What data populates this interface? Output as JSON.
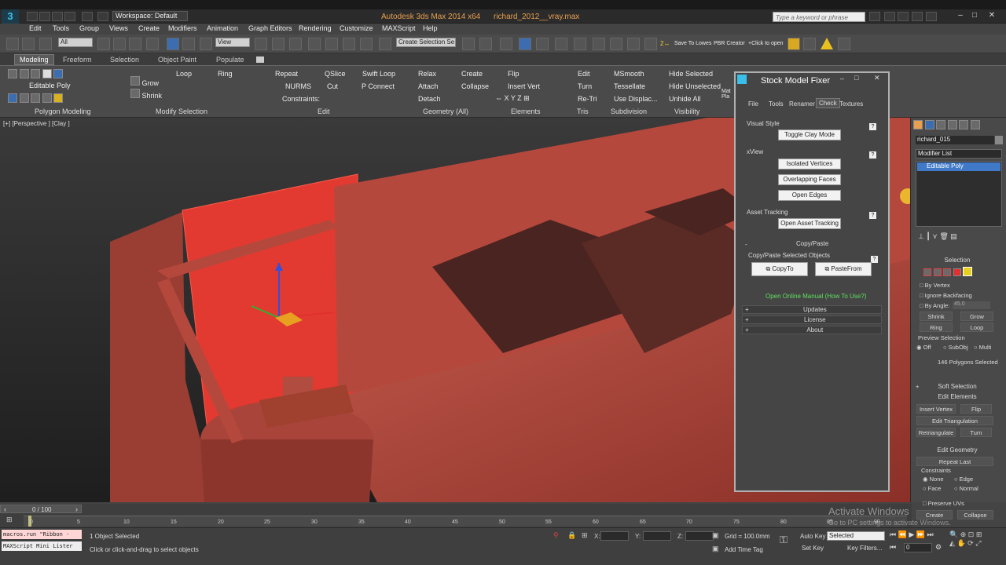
{
  "app": {
    "title": "Autodesk 3ds Max  2014 x64",
    "file": "richard_2012__vray.max",
    "workspace": "Workspace: Default",
    "search_placeholder": "Type a keyword or phrase"
  },
  "menu": [
    "Edit",
    "Tools",
    "Group",
    "Views",
    "Create",
    "Modifiers",
    "Animation",
    "Graph Editors",
    "Rendering",
    "Customize",
    "MAXScript",
    "Help"
  ],
  "toolbar": {
    "filter": "All",
    "view": "View",
    "selection_set": "Create Selection Se",
    "save_to_lowes": "Save To Lowes",
    "pbr_creator": "PBR Creator",
    "click_to_open": "+Click to open"
  },
  "ribbon_tabs": [
    "Modeling",
    "Freeform",
    "Selection",
    "Object Paint",
    "Populate"
  ],
  "ribbon": {
    "editable_poly": "Editable Poly",
    "polygon_modeling": "Polygon Modeling",
    "modify_selection": "Modify Selection",
    "edit": "Edit",
    "geometry_all": "Geometry (All)",
    "elements": "Elements",
    "tris": "Tris",
    "subdivision": "Subdivision",
    "visibility": "Visibility",
    "grow": "Grow",
    "shrink": "Shrink",
    "loop": "Loop",
    "ring": "Ring",
    "repeat": "Repeat",
    "qslice": "QSlice",
    "swift_loop": "Swift Loop",
    "nurms": "NURMS",
    "cut": "Cut",
    "p_connect": "P Connect",
    "constraints": "Constraints:",
    "relax": "Relax",
    "create": "Create",
    "attach": "Attach",
    "collapse": "Collapse",
    "detach": "Detach",
    "flip": "Flip",
    "insert_vert": "Insert Vert",
    "edit_tris": "Edit",
    "turn": "Turn",
    "re_tri": "Re-Tri",
    "msmooth": "MSmooth",
    "tessellate": "Tessellate",
    "use_displac": "Use Displac...",
    "hide_selected": "Hide Selected",
    "hide_unselected": "Hide Unselected",
    "unhide_all": "Unhide All",
    "mat_pla": "Mat Pla"
  },
  "viewport": {
    "label": "[+] [Perspective ] [Clay ]"
  },
  "stock_model_fixer": {
    "title": "Stock Model Fixer",
    "tabs": [
      "File",
      "Tools",
      "Renamer",
      "Check",
      "Textures"
    ],
    "active_tab": "Check",
    "visual_style": "Visual Style",
    "toggle_clay": "Toggle Clay Mode",
    "xview": "xView",
    "isolated_vertices": "Isolated Vertices",
    "overlapping_faces": "Overlapping Faces",
    "open_edges": "Open Edges",
    "asset_tracking": "Asset Tracking",
    "open_asset_tracking": "Open Asset Tracking",
    "copy_paste_header": "Copy/Paste",
    "copy_paste_selected": "Copy/Paste Selected Objects",
    "copy_to": "CopyTo",
    "paste_from": "PasteFrom",
    "online_manual": "Open Online Manual (How To Use?)",
    "updates": "Updates",
    "license": "License",
    "about": "About",
    "help": "?",
    "plus": "+",
    "minus": "-"
  },
  "command_panel": {
    "object_name": "richard_015",
    "modifier_list": "Modifier List",
    "stack_item": "Editable Poly",
    "selection": "Selection",
    "by_vertex": "By Vertex",
    "ignore_backfacing": "Ignore Backfacing",
    "by_angle": "By Angle:",
    "angle_value": "45.0",
    "shrink": "Shrink",
    "grow": "Grow",
    "ring": "Ring",
    "loop": "Loop",
    "preview_selection": "Preview Selection",
    "off": "Off",
    "subobj": "SubObj",
    "multi": "Multi",
    "polygons_selected": "146 Polygons Selected",
    "soft_selection": "Soft Selection",
    "edit_elements": "Edit Elements",
    "insert_vertex": "Insert Vertex",
    "flip": "Flip",
    "edit_triangulation": "Edit Triangulation",
    "retriangulate": "Retriangulate",
    "turn": "Turn",
    "edit_geometry": "Edit Geometry",
    "repeat_last": "Repeat Last",
    "constraints": "Constraints",
    "none": "None",
    "edge": "Edge",
    "face": "Face",
    "normal": "Normal",
    "preserve_uvs": "Preserve UVs",
    "create": "Create",
    "collapse": "Collapse"
  },
  "timeline": {
    "frame": "0 / 100",
    "ticks": [
      "0",
      "5",
      "10",
      "15",
      "20",
      "25",
      "30",
      "35",
      "40",
      "45",
      "50",
      "55",
      "60",
      "65",
      "70",
      "75",
      "80",
      "85",
      "90"
    ]
  },
  "status": {
    "macro1": "macros.run \"Ribbon -",
    "macro2": "MAXScript Mini Lister",
    "objects_selected": "1 Object Selected",
    "prompt": "Click or click-and-drag to select objects",
    "x_label": "X:",
    "y_label": "Y:",
    "z_label": "Z:",
    "grid": "Grid = 100.0mm",
    "add_time_tag": "Add Time Tag",
    "auto_key": "Auto Key",
    "set_key": "Set Key",
    "selected": "Selected",
    "key_filters": "Key Filters...",
    "frame_value": "0",
    "activate_windows": "Activate Windows",
    "activate_windows_sub": "Go to PC settings to activate Windows."
  },
  "colors": {
    "model_red": "#b5483d",
    "selection_red": "#e8372e",
    "accent_orange": "#e8a050",
    "link_green": "#5ee05e"
  }
}
